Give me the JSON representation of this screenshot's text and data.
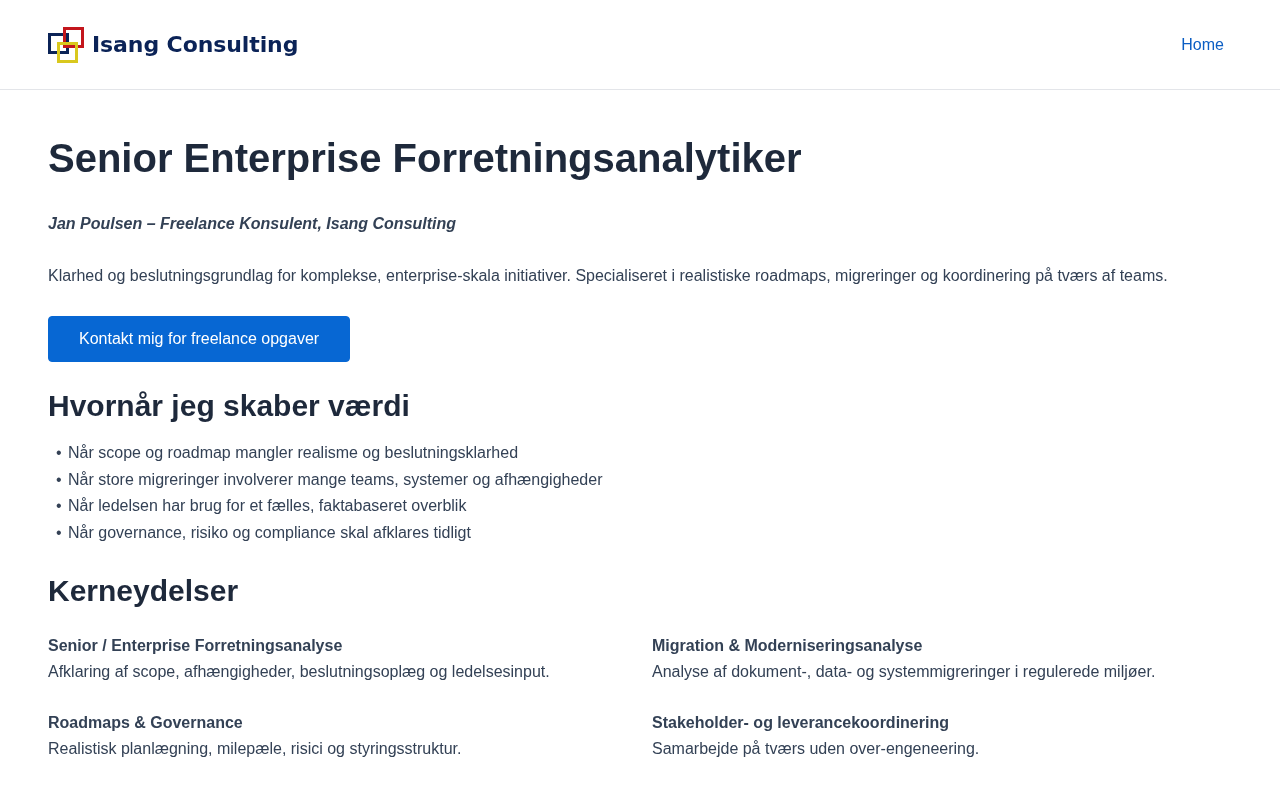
{
  "header": {
    "logo": {
      "text": "Isang Consulting"
    },
    "nav": [
      {
        "label": "Home"
      }
    ]
  },
  "hero": {
    "title": "Senior Enterprise Forretningsanalytiker",
    "byline": "Jan Poulsen – Freelance Konsulent, Isang Consulting",
    "intro": "Klarhed og beslutningsgrundlag for komplekse, enterprise-skala initiativer. Specialiseret i realistiske roadmaps, migreringer og koordinering på tværs af teams.",
    "cta": "Kontakt mig for freelance opgaver"
  },
  "sections": [
    {
      "heading": "Hvornår jeg skaber værdi",
      "kind": "list",
      "items": [
        {
          "marker": "•",
          "text": "Når scope og roadmap mangler realisme og beslutningsklarhed"
        },
        {
          "marker": "•",
          "text": "Når store migreringer involverer mange teams, systemer og afhængigheder"
        },
        {
          "marker": "•",
          "text": "Når ledelsen har brug for et fælles, faktabaseret overblik"
        },
        {
          "marker": "•",
          "text": "Når governance, risiko og compliance skal afklares tidligt"
        }
      ]
    },
    {
      "heading": "Kerneydelser",
      "kind": "grid",
      "items": [
        {
          "title": "Senior / Enterprise Forretningsanalyse",
          "text": "Afklaring af scope, afhængigheder, beslutningsoplæg og ledelsesinput."
        },
        {
          "title": "Migration & Moderniseringsanalyse",
          "text": "Analyse af dokument-, data- og systemmigreringer i regulerede miljøer."
        },
        {
          "title": "Roadmaps & Governance",
          "text": "Realistisk planlægning, milepæle, risici og styringsstruktur."
        },
        {
          "title": "Stakeholder- og leverancekoordinering",
          "text": "Samarbejde på tværs uden over-engeneering."
        }
      ]
    }
  ]
}
